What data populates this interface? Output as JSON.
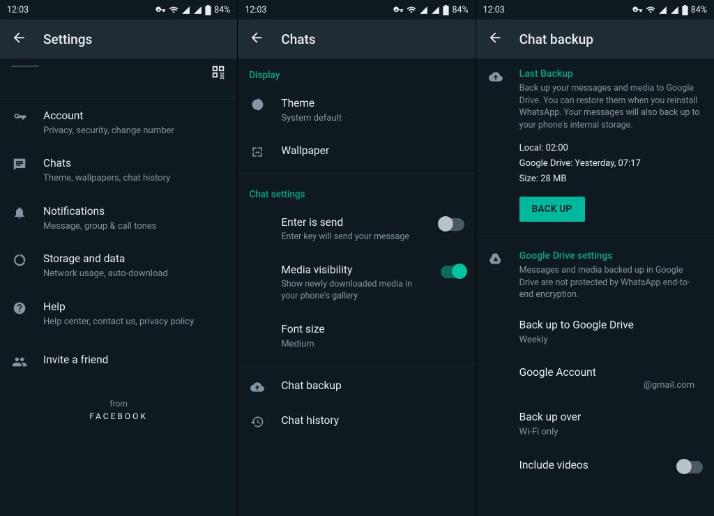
{
  "status": {
    "time": "12:03",
    "battery": "84%"
  },
  "pane1": {
    "title": "Settings",
    "items": [
      {
        "title": "Account",
        "sub": "Privacy, security, change number"
      },
      {
        "title": "Chats",
        "sub": "Theme, wallpapers, chat history"
      },
      {
        "title": "Notifications",
        "sub": "Message, group & call tones"
      },
      {
        "title": "Storage and data",
        "sub": "Network usage, auto-download"
      },
      {
        "title": "Help",
        "sub": "Help center, contact us, privacy policy"
      },
      {
        "title": "Invite a friend"
      }
    ],
    "footer_from": "from",
    "footer_brand": "FACEBOOK"
  },
  "pane2": {
    "title": "Chats",
    "sec_display": "Display",
    "theme": {
      "title": "Theme",
      "sub": "System default"
    },
    "wallpaper": "Wallpaper",
    "sec_chat": "Chat settings",
    "enter": {
      "title": "Enter is send",
      "sub": "Enter key will send your message"
    },
    "media": {
      "title": "Media visibility",
      "sub": "Show newly downloaded media in your phone's gallery"
    },
    "font": {
      "title": "Font size",
      "sub": "Medium"
    },
    "backup": "Chat backup",
    "history": "Chat history"
  },
  "pane3": {
    "title": "Chat backup",
    "last_backup_title": "Last Backup",
    "last_backup_desc": "Back up your messages and media to Google Drive. You can restore them when you reinstall WhatsApp. Your messages will also back up to your phone's internal storage.",
    "local": "Local: 02:00",
    "gdrive": "Google Drive: Yesterday, 07:17",
    "size": "Size: 28 MB",
    "backup_btn": "BACK UP",
    "gd_title": "Google Drive settings",
    "gd_desc": "Messages and media backed up in Google Drive are not protected by WhatsApp end-to-end encryption.",
    "freq_title": "Back up to Google Drive",
    "freq_val": "Weekly",
    "acct_title": "Google Account",
    "acct_val": "@gmail.com",
    "over_title": "Back up over",
    "over_val": "Wi-Fi only",
    "videos": "Include videos"
  }
}
